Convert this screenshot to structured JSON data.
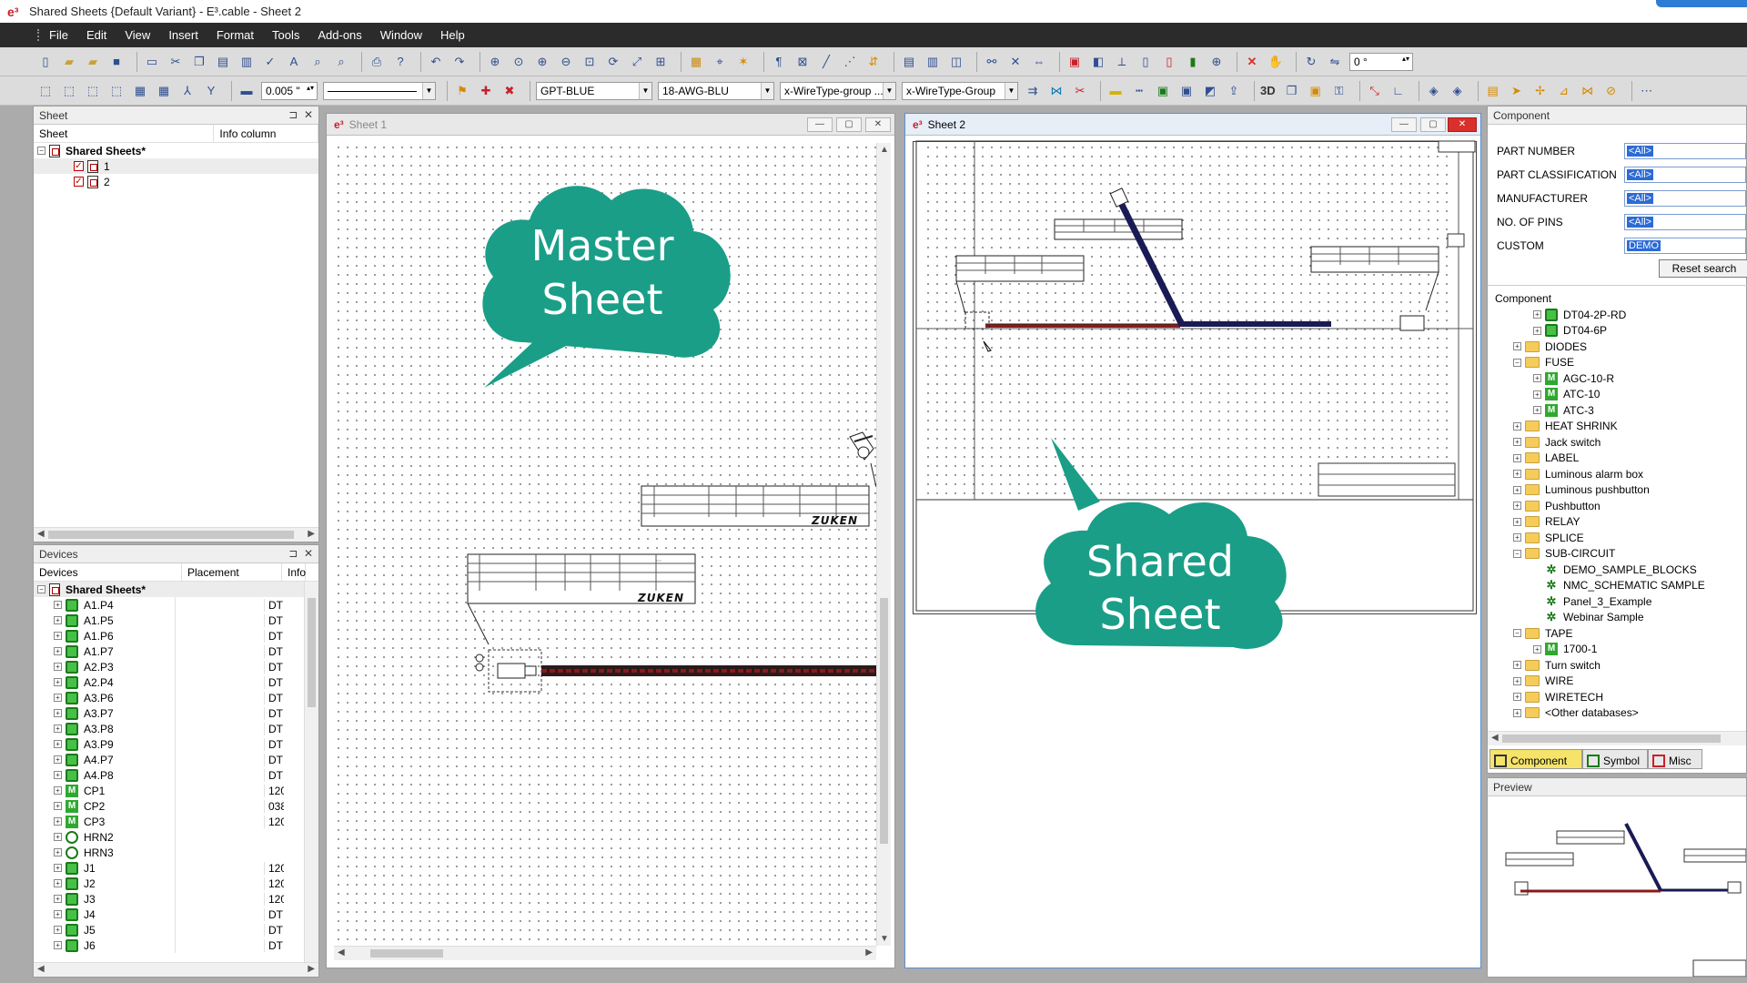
{
  "window": {
    "title": "Shared Sheets {Default Variant} - E³.cable - Sheet 2"
  },
  "menu": [
    "File",
    "Edit",
    "View",
    "Insert",
    "Format",
    "Tools",
    "Add-ons",
    "Window",
    "Help"
  ],
  "toolbar": {
    "line_width": "0.005 \"",
    "rotation": "0 °",
    "color_combo": "GPT-BLUE",
    "wire_combo": "18-AWG-BLU",
    "wiretype_group_1": "x-WireType-group ...",
    "wiretype_group_2": "x-WireType-Group",
    "label_3d": "3D"
  },
  "sheet_panel": {
    "title": "Sheet",
    "col_sheet": "Sheet",
    "col_info": "Info column",
    "root": "Shared Sheets*",
    "items": [
      "1",
      "2"
    ]
  },
  "devices_panel": {
    "title": "Devices",
    "col_devices": "Devices",
    "col_placement": "Placement",
    "col_info": "Info",
    "root": "Shared Sheets*",
    "items": [
      {
        "name": "A1.P4",
        "info": "DTI",
        "icon": "device"
      },
      {
        "name": "A1.P5",
        "info": "DTI",
        "icon": "device"
      },
      {
        "name": "A1.P6",
        "info": "DTI",
        "icon": "device"
      },
      {
        "name": "A1.P7",
        "info": "DTI",
        "icon": "device"
      },
      {
        "name": "A2.P3",
        "info": "DTI",
        "icon": "device"
      },
      {
        "name": "A2.P4",
        "info": "DTI",
        "icon": "device"
      },
      {
        "name": "A3.P6",
        "info": "DTI",
        "icon": "device"
      },
      {
        "name": "A3.P7",
        "info": "DTI",
        "icon": "device"
      },
      {
        "name": "A3.P8",
        "info": "DTI",
        "icon": "device"
      },
      {
        "name": "A3.P9",
        "info": "DTI",
        "icon": "device"
      },
      {
        "name": "A4.P7",
        "info": "DTI",
        "icon": "device"
      },
      {
        "name": "A4.P8",
        "info": "DTI",
        "icon": "device"
      },
      {
        "name": "CP1",
        "info": "120",
        "icon": "cp"
      },
      {
        "name": "CP2",
        "info": "038",
        "icon": "cp"
      },
      {
        "name": "CP3",
        "info": "120",
        "icon": "cp"
      },
      {
        "name": "HRN2",
        "info": "",
        "icon": "harness"
      },
      {
        "name": "HRN3",
        "info": "",
        "icon": "harness"
      },
      {
        "name": "J1",
        "info": "120",
        "icon": "device"
      },
      {
        "name": "J2",
        "info": "120",
        "icon": "device"
      },
      {
        "name": "J3",
        "info": "120",
        "icon": "device"
      },
      {
        "name": "J4",
        "info": "DTI",
        "icon": "device"
      },
      {
        "name": "J5",
        "info": "DTI",
        "icon": "device"
      },
      {
        "name": "J6",
        "info": "DTI",
        "icon": "device"
      }
    ]
  },
  "sheet1_window": {
    "title": "Sheet 1"
  },
  "sheet2_window": {
    "title": "Sheet 2"
  },
  "callouts": {
    "master": [
      "Master",
      "Sheet"
    ],
    "shared": [
      "Shared",
      "Sheet"
    ]
  },
  "drawing": {
    "logo_text": "ZUKEN"
  },
  "component_panel": {
    "title": "Component",
    "fields": [
      {
        "label": "PART NUMBER",
        "value": "<All>"
      },
      {
        "label": "PART CLASSIFICATION",
        "value": "<All>"
      },
      {
        "label": "MANUFACTURER",
        "value": "<All>"
      },
      {
        "label": "NO. OF PINS",
        "value": "<All>"
      },
      {
        "label": "CUSTOM",
        "value": "DEMO"
      }
    ],
    "reset_label": "Reset search",
    "tree_header": "Component",
    "tree": [
      {
        "label": "DT04-2P-RD",
        "level": 2,
        "icon": "device"
      },
      {
        "label": "DT04-6P",
        "level": 2,
        "icon": "device"
      },
      {
        "label": "DIODES",
        "level": 1,
        "icon": "folder",
        "exp": "+"
      },
      {
        "label": "FUSE",
        "level": 1,
        "icon": "folder",
        "exp": "-"
      },
      {
        "label": "AGC-10-R",
        "level": 2,
        "icon": "fuse"
      },
      {
        "label": "ATC-10",
        "level": 2,
        "icon": "fuse"
      },
      {
        "label": "ATC-3",
        "level": 2,
        "icon": "fuse"
      },
      {
        "label": "HEAT SHRINK",
        "level": 1,
        "icon": "folder",
        "exp": "+"
      },
      {
        "label": "Jack switch",
        "level": 1,
        "icon": "folder",
        "exp": "+"
      },
      {
        "label": "LABEL",
        "level": 1,
        "icon": "folder",
        "exp": "+"
      },
      {
        "label": "Luminous alarm box",
        "level": 1,
        "icon": "folder",
        "exp": "+"
      },
      {
        "label": "Luminous pushbutton",
        "level": 1,
        "icon": "folder",
        "exp": "+"
      },
      {
        "label": "Pushbutton",
        "level": 1,
        "icon": "folder",
        "exp": "+"
      },
      {
        "label": "RELAY",
        "level": 1,
        "icon": "folder",
        "exp": "+"
      },
      {
        "label": "SPLICE",
        "level": 1,
        "icon": "folder",
        "exp": "+"
      },
      {
        "label": "SUB-CIRCUIT",
        "level": 1,
        "icon": "folder",
        "exp": "-"
      },
      {
        "label": "DEMO_SAMPLE_BLOCKS",
        "level": 2,
        "icon": "subcircuit"
      },
      {
        "label": "NMC_SCHEMATIC SAMPLE",
        "level": 2,
        "icon": "subcircuit"
      },
      {
        "label": "Panel_3_Example",
        "level": 2,
        "icon": "subcircuit"
      },
      {
        "label": "Webinar Sample",
        "level": 2,
        "icon": "subcircuit"
      },
      {
        "label": "TAPE",
        "level": 1,
        "icon": "folder",
        "exp": "-"
      },
      {
        "label": "1700-1",
        "level": 2,
        "icon": "fuse"
      },
      {
        "label": "Turn switch",
        "level": 1,
        "icon": "folder",
        "exp": "+"
      },
      {
        "label": "WIRE",
        "level": 1,
        "icon": "folder",
        "exp": "+"
      },
      {
        "label": "WIRETECH",
        "level": 1,
        "icon": "folder",
        "exp": "+"
      },
      {
        "label": "<Other databases>",
        "level": 1,
        "icon": "folder",
        "exp": "+"
      }
    ],
    "tabs": [
      "Component",
      "Symbol",
      "Misc"
    ]
  },
  "preview_panel": {
    "title": "Preview"
  },
  "colors": {
    "callout": "#1a9e87",
    "menubar": "#2b2b2b",
    "wire_dark": "#1a1a55",
    "wire_red": "#8a1a1a"
  }
}
